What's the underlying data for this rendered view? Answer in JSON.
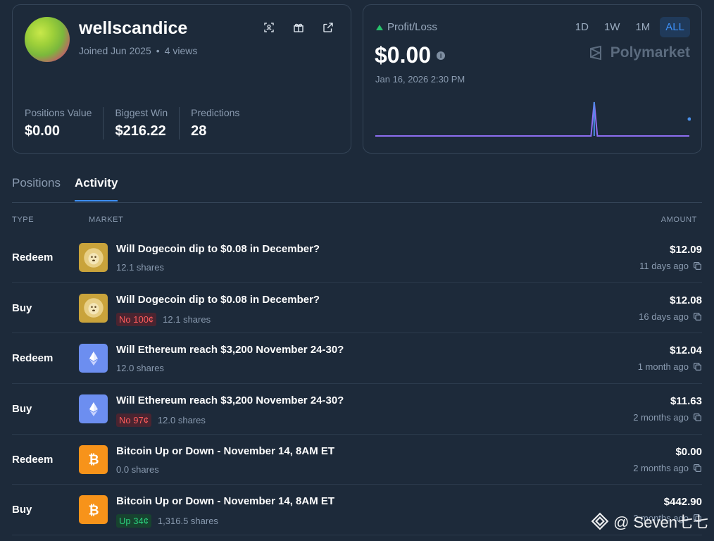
{
  "profile": {
    "username": "wellscandice",
    "joined": "Joined Jun 2025",
    "views": "4 views",
    "stats": [
      {
        "label": "Positions Value",
        "value": "$0.00"
      },
      {
        "label": "Biggest Win",
        "value": "$216.22"
      },
      {
        "label": "Predictions",
        "value": "28"
      }
    ]
  },
  "pnl": {
    "label": "Profit/Loss",
    "value": "$0.00",
    "date": "Jan 16, 2026 2:30 PM",
    "brand": "Polymarket",
    "ranges": [
      "1D",
      "1W",
      "1M",
      "ALL"
    ],
    "active_range": "ALL",
    "colors": {
      "line": "#8d6ef0",
      "spike": "#4a8fe8",
      "up": "#27c26b"
    },
    "chart_data": {
      "type": "line",
      "series": [
        {
          "values": [
            0,
            0,
            0,
            0,
            0,
            0,
            0,
            0,
            0,
            0,
            0,
            0,
            0,
            0,
            0,
            0,
            0,
            0,
            0,
            0,
            0,
            0,
            0,
            0,
            0,
            0,
            0,
            0,
            0,
            0,
            0,
            0,
            0,
            0,
            0,
            0,
            0,
            0,
            0,
            0,
            0,
            0,
            0,
            0,
            0,
            0,
            0,
            0,
            0,
            0,
            0,
            0,
            0,
            0,
            0,
            0,
            0,
            0,
            0,
            0,
            0,
            0,
            0,
            0,
            0,
            0,
            0,
            0,
            0,
            216.22,
            0,
            0,
            0,
            0,
            0,
            0,
            0,
            0,
            0,
            0,
            0,
            0,
            0,
            0,
            0,
            0,
            0,
            0,
            0,
            0,
            0,
            0,
            0,
            0,
            0,
            0,
            0,
            0,
            0,
            0
          ]
        }
      ]
    }
  },
  "tabs": [
    {
      "label": "Positions",
      "active": false
    },
    {
      "label": "Activity",
      "active": true
    }
  ],
  "table": {
    "headers": {
      "type": "TYPE",
      "market": "MARKET",
      "amount": "AMOUNT"
    },
    "rows": [
      {
        "type": "Redeem",
        "icon": "dogecoin-icon",
        "title": "Will Dogecoin dip to $0.08 in December?",
        "badge": "",
        "badge_kind": "",
        "shares": "12.1 shares",
        "amount": "$12.09",
        "time": "11 days ago"
      },
      {
        "type": "Buy",
        "icon": "dogecoin-icon",
        "title": "Will Dogecoin dip to $0.08 in December?",
        "badge": "No 100¢",
        "badge_kind": "no",
        "shares": "12.1 shares",
        "amount": "$12.08",
        "time": "16 days ago"
      },
      {
        "type": "Redeem",
        "icon": "ethereum-icon",
        "title": "Will Ethereum reach $3,200 November 24-30?",
        "badge": "",
        "badge_kind": "",
        "shares": "12.0 shares",
        "amount": "$12.04",
        "time": "1 month ago"
      },
      {
        "type": "Buy",
        "icon": "ethereum-icon",
        "title": "Will Ethereum reach $3,200 November 24-30?",
        "badge": "No 97¢",
        "badge_kind": "no",
        "shares": "12.0 shares",
        "amount": "$11.63",
        "time": "2 months ago"
      },
      {
        "type": "Redeem",
        "icon": "bitcoin-icon",
        "title": "Bitcoin Up or Down - November 14, 8AM ET",
        "badge": "",
        "badge_kind": "",
        "shares": "0.0 shares",
        "amount": "$0.00",
        "time": "2 months ago"
      },
      {
        "type": "Buy",
        "icon": "bitcoin-icon",
        "title": "Bitcoin Up or Down - November 14, 8AM ET",
        "badge": "Up 34¢",
        "badge_kind": "up",
        "shares": "1,316.5 shares",
        "amount": "$442.90",
        "time": "2 months ago"
      }
    ]
  },
  "watermark": "@ Seven七七"
}
